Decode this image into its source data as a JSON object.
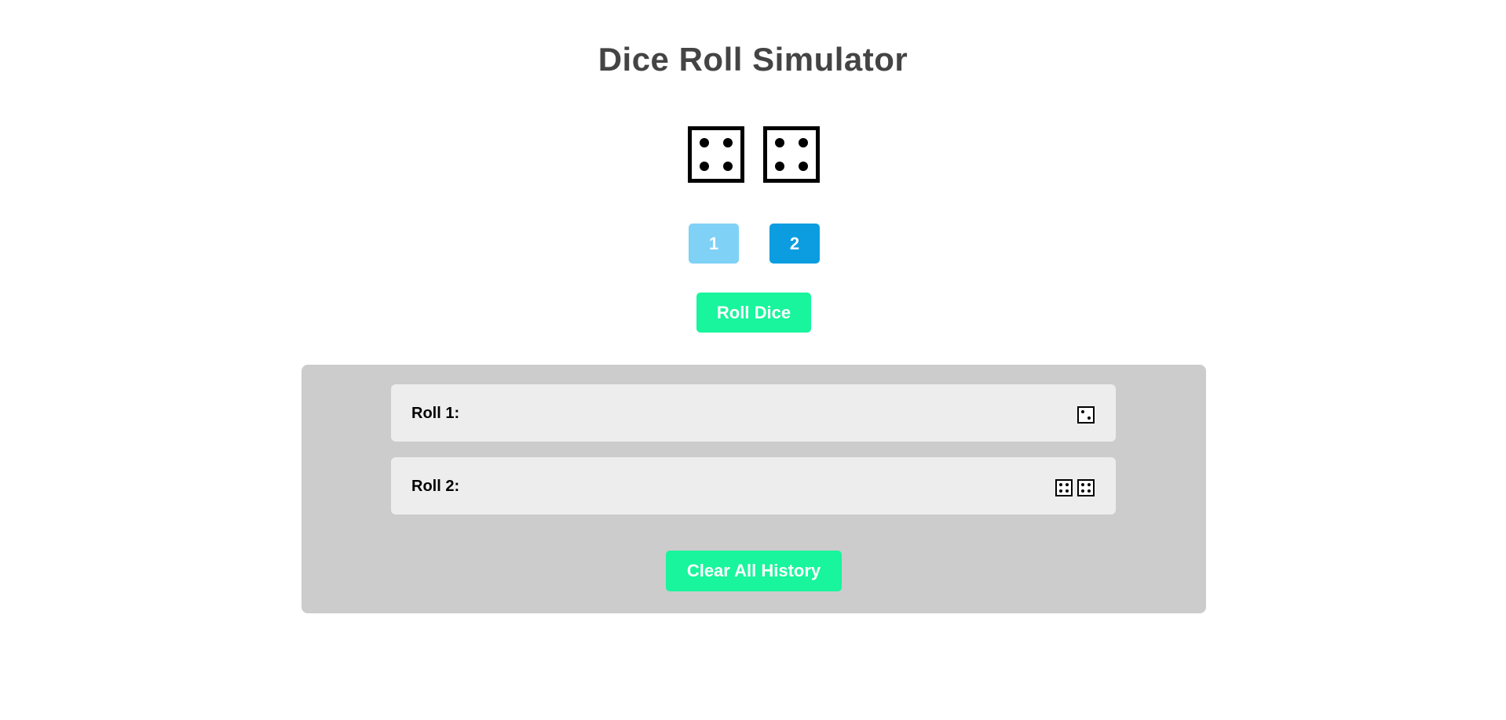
{
  "app": {
    "title": "Dice Roll Simulator"
  },
  "current_roll": {
    "dice": [
      {
        "value": 4,
        "icon": "die-face-four-icon"
      },
      {
        "value": 4,
        "icon": "die-face-four-icon"
      }
    ]
  },
  "dice_count": {
    "options": [
      {
        "label": "1",
        "selected": false,
        "color": "#7fd1f6"
      },
      {
        "label": "2",
        "selected": true,
        "color": "#0b9de0"
      }
    ]
  },
  "actions": {
    "roll_label": "Roll Dice",
    "clear_label": "Clear All History",
    "accent_color": "#18f59c"
  },
  "history": {
    "rows": [
      {
        "label": "Roll 1:",
        "dice": [
          {
            "value": 2,
            "icon": "die-face-two-icon"
          }
        ]
      },
      {
        "label": "Roll 2:",
        "dice": [
          {
            "value": 4,
            "icon": "die-face-four-icon"
          },
          {
            "value": 4,
            "icon": "die-face-four-icon"
          }
        ]
      }
    ]
  }
}
